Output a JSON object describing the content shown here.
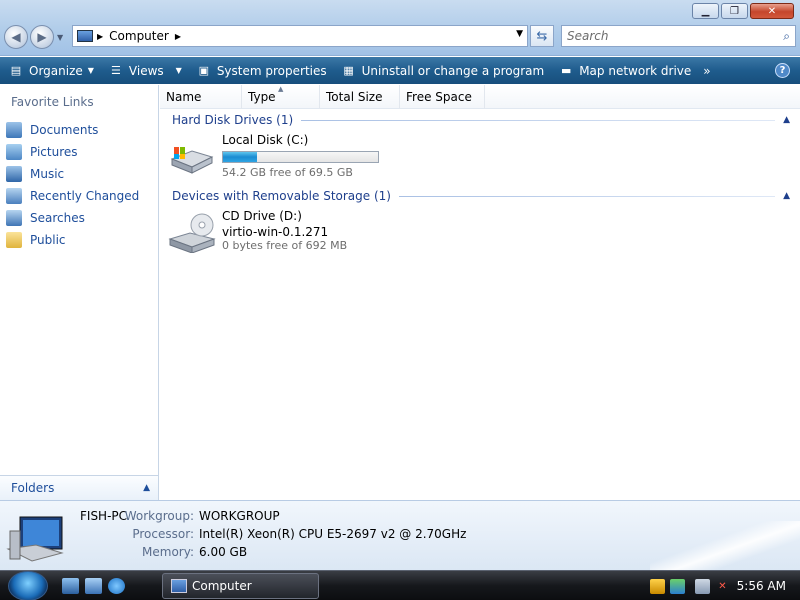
{
  "window": {
    "minimize_icon": "minimize-icon",
    "maximize_icon": "restore-icon",
    "close_icon": "close-icon"
  },
  "address": {
    "crumbs": [
      "Computer"
    ]
  },
  "search": {
    "placeholder": "Search"
  },
  "toolbar": {
    "organize": "Organize",
    "views": "Views",
    "system_properties": "System properties",
    "uninstall": "Uninstall or change a program",
    "map_drive": "Map network drive",
    "more": "»"
  },
  "sidebar": {
    "title": "Favorite Links",
    "items": [
      {
        "label": "Documents"
      },
      {
        "label": "Pictures"
      },
      {
        "label": "Music"
      },
      {
        "label": "Recently Changed"
      },
      {
        "label": "Searches"
      },
      {
        "label": "Public"
      }
    ],
    "folders_label": "Folders"
  },
  "columns": [
    "Name",
    "Type",
    "Total Size",
    "Free Space"
  ],
  "groups": [
    {
      "title": "Hard Disk Drives (1)",
      "items": [
        {
          "name": "Local Disk (C:)",
          "free": "54.2 GB free of 69.5 GB",
          "used_fraction": 0.22
        }
      ]
    },
    {
      "title": "Devices with Removable Storage (1)",
      "items": [
        {
          "name": "CD Drive (D:)",
          "label": "virtio-win-0.1.271",
          "free": "0 bytes free of 692 MB"
        }
      ]
    }
  ],
  "details": {
    "computer_name": "FISH-PC",
    "workgroup_label": "Workgroup:",
    "workgroup": "WORKGROUP",
    "processor_label": "Processor:",
    "processor": "Intel(R) Xeon(R) CPU E5-2697 v2 @ 2.70GHz",
    "memory_label": "Memory:",
    "memory": "6.00 GB"
  },
  "taskbar": {
    "task_label": "Computer",
    "time": "5:56 AM"
  },
  "colors": {
    "command_bar": "#1f5c8d",
    "link_blue": "#1e4e9b",
    "group_blue": "#1e3f8c"
  }
}
